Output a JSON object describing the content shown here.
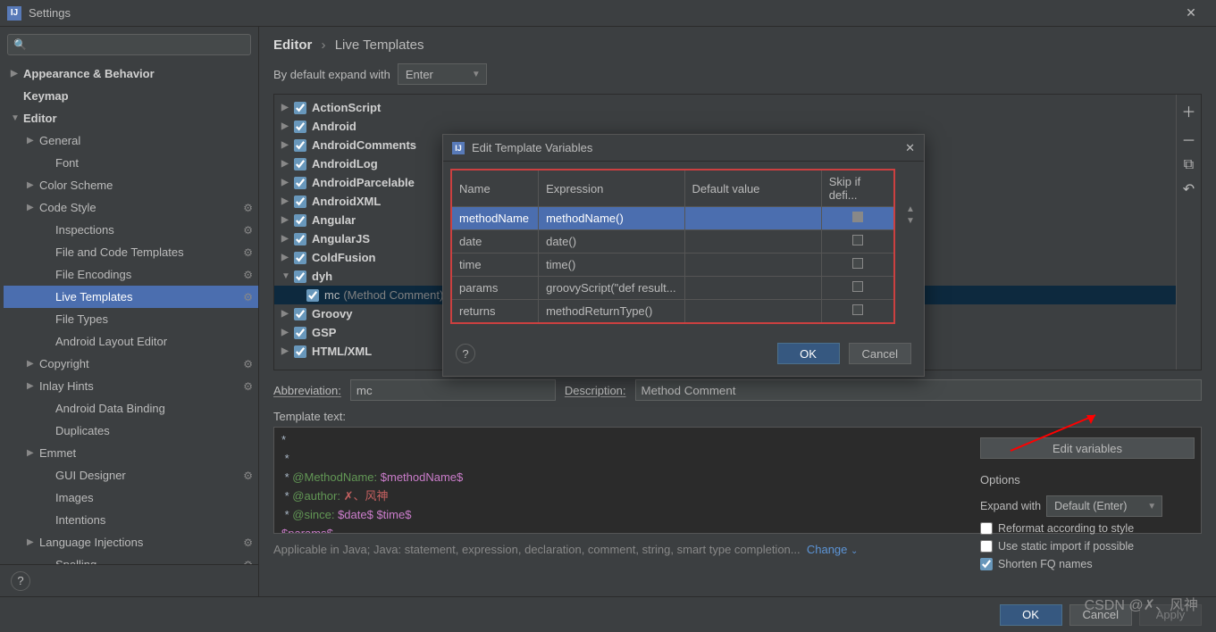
{
  "window": {
    "title": "Settings"
  },
  "search": {
    "placeholder": ""
  },
  "sidebar": {
    "items": [
      {
        "label": "Appearance & Behavior",
        "arrow": "▶",
        "bold": true,
        "indent": 0,
        "gear": false
      },
      {
        "label": "Keymap",
        "arrow": "",
        "bold": true,
        "indent": 0,
        "gear": false
      },
      {
        "label": "Editor",
        "arrow": "▼",
        "bold": true,
        "indent": 0,
        "gear": false
      },
      {
        "label": "General",
        "arrow": "▶",
        "bold": false,
        "indent": 1,
        "gear": false
      },
      {
        "label": "Font",
        "arrow": "",
        "bold": false,
        "indent": 2,
        "gear": false
      },
      {
        "label": "Color Scheme",
        "arrow": "▶",
        "bold": false,
        "indent": 1,
        "gear": false
      },
      {
        "label": "Code Style",
        "arrow": "▶",
        "bold": false,
        "indent": 1,
        "gear": true
      },
      {
        "label": "Inspections",
        "arrow": "",
        "bold": false,
        "indent": 2,
        "gear": true
      },
      {
        "label": "File and Code Templates",
        "arrow": "",
        "bold": false,
        "indent": 2,
        "gear": true
      },
      {
        "label": "File Encodings",
        "arrow": "",
        "bold": false,
        "indent": 2,
        "gear": true
      },
      {
        "label": "Live Templates",
        "arrow": "",
        "bold": false,
        "indent": 2,
        "gear": true,
        "selected": true
      },
      {
        "label": "File Types",
        "arrow": "",
        "bold": false,
        "indent": 2,
        "gear": false
      },
      {
        "label": "Android Layout Editor",
        "arrow": "",
        "bold": false,
        "indent": 2,
        "gear": false
      },
      {
        "label": "Copyright",
        "arrow": "▶",
        "bold": false,
        "indent": 1,
        "gear": true
      },
      {
        "label": "Inlay Hints",
        "arrow": "▶",
        "bold": false,
        "indent": 1,
        "gear": true
      },
      {
        "label": "Android Data Binding",
        "arrow": "",
        "bold": false,
        "indent": 2,
        "gear": false
      },
      {
        "label": "Duplicates",
        "arrow": "",
        "bold": false,
        "indent": 2,
        "gear": false
      },
      {
        "label": "Emmet",
        "arrow": "▶",
        "bold": false,
        "indent": 1,
        "gear": false
      },
      {
        "label": "GUI Designer",
        "arrow": "",
        "bold": false,
        "indent": 2,
        "gear": true
      },
      {
        "label": "Images",
        "arrow": "",
        "bold": false,
        "indent": 2,
        "gear": false
      },
      {
        "label": "Intentions",
        "arrow": "",
        "bold": false,
        "indent": 2,
        "gear": false
      },
      {
        "label": "Language Injections",
        "arrow": "▶",
        "bold": false,
        "indent": 1,
        "gear": true
      },
      {
        "label": "Spelling",
        "arrow": "",
        "bold": false,
        "indent": 2,
        "gear": true
      }
    ]
  },
  "breadcrumb": {
    "root": "Editor",
    "leaf": "Live Templates"
  },
  "expand_row": {
    "label": "By default expand with",
    "value": "Enter"
  },
  "groups": [
    {
      "label": "ActionScript",
      "arrow": "▶",
      "checked": true
    },
    {
      "label": "Android",
      "arrow": "▶",
      "checked": true
    },
    {
      "label": "AndroidComments",
      "arrow": "▶",
      "checked": true
    },
    {
      "label": "AndroidLog",
      "arrow": "▶",
      "checked": true
    },
    {
      "label": "AndroidParcelable",
      "arrow": "▶",
      "checked": true
    },
    {
      "label": "AndroidXML",
      "arrow": "▶",
      "checked": true
    },
    {
      "label": "Angular",
      "arrow": "▶",
      "checked": true
    },
    {
      "label": "AngularJS",
      "arrow": "▶",
      "checked": true
    },
    {
      "label": "ColdFusion",
      "arrow": "▶",
      "checked": true
    },
    {
      "label": "dyh",
      "arrow": "▼",
      "checked": true,
      "children": [
        {
          "name": "mc",
          "desc": "(Method Comment)",
          "checked": true,
          "selected": true
        }
      ]
    },
    {
      "label": "Groovy",
      "arrow": "▶",
      "checked": true
    },
    {
      "label": "GSP",
      "arrow": "▶",
      "checked": true
    },
    {
      "label": "HTML/XML",
      "arrow": "▶",
      "checked": true
    }
  ],
  "side_buttons": {
    "add": "＋",
    "remove": "－",
    "copy": "⧉",
    "undo": "↶"
  },
  "form": {
    "abbrev_label": "Abbreviation:",
    "abbrev_value": "mc",
    "desc_label": "Description:",
    "desc_value": "Method Comment",
    "template_label": "Template text:"
  },
  "template_lines": {
    "l0": "*",
    "l1": " * ",
    "l2_a": " * ",
    "l2_tag": "@MethodName:",
    "l2_var": " $methodName$",
    "l3_a": " * ",
    "l3_tag": "@author:",
    "l3_txt": " ✗、风神",
    "l4_a": " * ",
    "l4_tag": "@since:",
    "l4_var": " $date$ $time$",
    "l5_var": "$params$"
  },
  "applicable": {
    "text": "Applicable in Java; Java: statement, expression, declaration, comment, string, smart type completion...",
    "link": "Change"
  },
  "edit_vars_btn": "Edit variables",
  "options": {
    "title": "Options",
    "expand_label": "Expand with",
    "expand_value": "Default (Enter)",
    "reformat": "Reformat according to style",
    "static_import": "Use static import if possible",
    "shorten": "Shorten FQ names"
  },
  "footer": {
    "ok": "OK",
    "cancel": "Cancel",
    "apply": "Apply"
  },
  "modal": {
    "title": "Edit Template Variables",
    "headers": {
      "name": "Name",
      "expr": "Expression",
      "default": "Default value",
      "skip": "Skip if defi..."
    },
    "rows": [
      {
        "name": "methodName",
        "expr": "methodName()",
        "default": "",
        "skip": true,
        "selected": true
      },
      {
        "name": "date",
        "expr": "date()",
        "default": "",
        "skip": false
      },
      {
        "name": "time",
        "expr": "time()",
        "default": "",
        "skip": false
      },
      {
        "name": "params",
        "expr": "groovyScript(\"def result...",
        "default": "",
        "skip": false
      },
      {
        "name": "returns",
        "expr": "methodReturnType()",
        "default": "",
        "skip": false
      }
    ],
    "ok": "OK",
    "cancel": "Cancel"
  },
  "watermark": "CSDN @✗、风神"
}
